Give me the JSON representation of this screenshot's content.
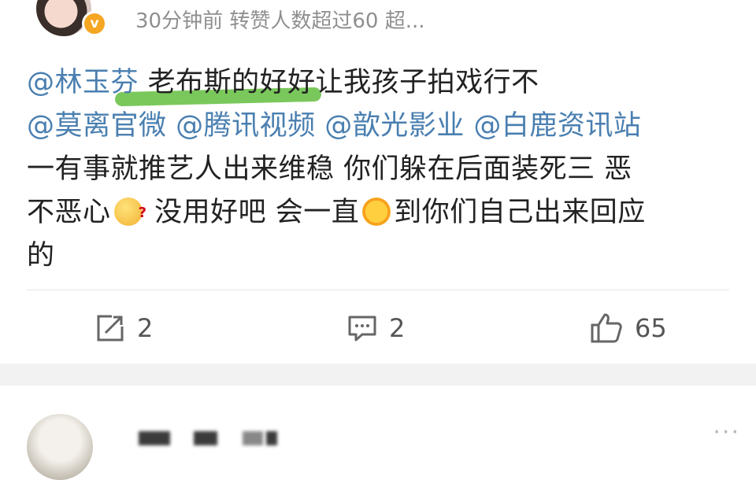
{
  "post": {
    "meta": "30分钟前 转赞人数超过60 超...",
    "badge_symbol": "v",
    "lines": [
      [
        {
          "t": "mention",
          "v": "@林玉芬"
        },
        {
          "t": "text",
          "v": " 老布斯的好好让我孩子拍戏行不"
        }
      ],
      [
        {
          "t": "mention",
          "v": "@莫离官微 @腾讯视频 @歆光影业 @白鹿资讯站"
        }
      ],
      [
        {
          "t": "text",
          "v": "一有事就推艺人出来维稳 你们躲在后面装死三 恶"
        }
      ],
      [
        {
          "t": "text",
          "v": "不恶心"
        },
        {
          "t": "emoji",
          "v": "thinking-emoji"
        },
        {
          "t": "text",
          "v": " 没用好吧 会一直"
        },
        {
          "t": "emoji",
          "v": "sun-emoji"
        },
        {
          "t": "text",
          "v": "到你们自己出来回应"
        }
      ],
      [
        {
          "t": "text",
          "v": "的"
        }
      ]
    ]
  },
  "actions": {
    "repost_count": "2",
    "comment_count": "2",
    "like_count": "65"
  },
  "colors": {
    "mention": "#4a7fb0",
    "highlight": "#6bc24a",
    "meta": "#8f8f8f",
    "badge": "#f5a623"
  },
  "second_post": {
    "more_icon": "···"
  }
}
